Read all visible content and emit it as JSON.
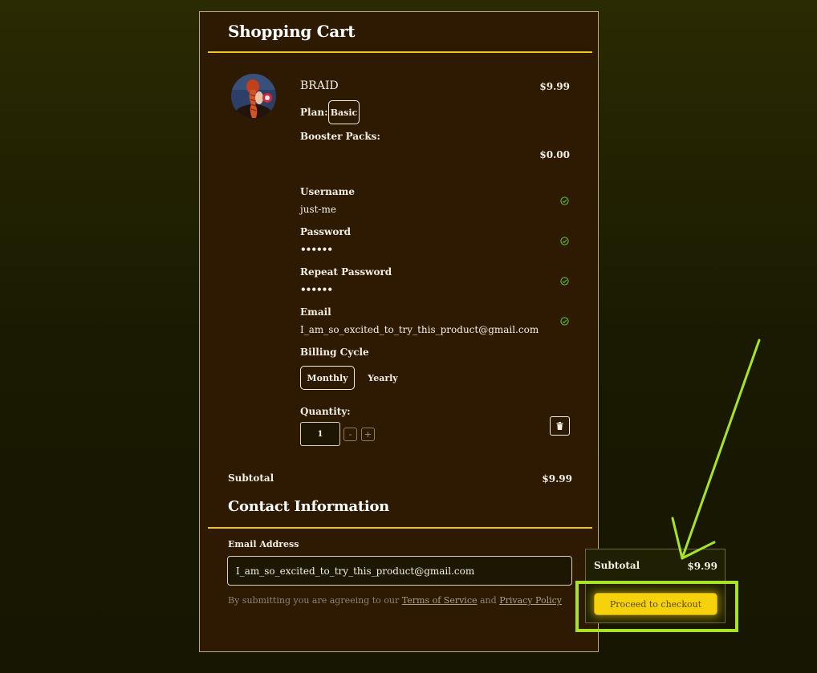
{
  "cart": {
    "title": "Shopping Cart",
    "product": {
      "name": "BRAID",
      "price": "$9.99",
      "plan_label": "Plan:",
      "plan_value": "Basic",
      "booster_label": "Booster Packs:",
      "booster_price": "$0.00"
    },
    "fields": [
      {
        "label": "Username",
        "value": "just-me"
      },
      {
        "label": "Password",
        "value": "••••••"
      },
      {
        "label": "Repeat Password",
        "value": "••••••"
      },
      {
        "label": "Email",
        "value": "I_am_so_excited_to_try_this_product@gmail.com"
      }
    ],
    "billing": {
      "label": "Billing Cycle",
      "options": [
        "Monthly",
        "Yearly"
      ],
      "selected": "Monthly"
    },
    "quantity": {
      "label": "Quantity:",
      "value": "1",
      "minus": "-",
      "plus": "+"
    },
    "subtotal_label": "Subtotal",
    "subtotal_value": "$9.99"
  },
  "contact": {
    "title": "Contact Information",
    "email_label": "Email Address",
    "email_value": "I_am_so_excited_to_try_this_product@gmail.com",
    "terms_prefix": "By submitting you are agreeing to our",
    "terms_link": "Terms of Service",
    "terms_and": "and",
    "privacy_link": "Privacy Policy"
  },
  "summary": {
    "subtotal_label": "Subtotal",
    "subtotal_value": "$9.99",
    "checkout_label": "Proceed to checkout"
  },
  "colors": {
    "panel_bg": "#2e1a03",
    "accent_yellow": "#f0c419",
    "check_green": "#66cc33",
    "annotation_green": "#a8e424"
  },
  "icons": {
    "status": "check-circle-icon",
    "delete": "trash-icon",
    "annotation": "arrow-icon"
  }
}
